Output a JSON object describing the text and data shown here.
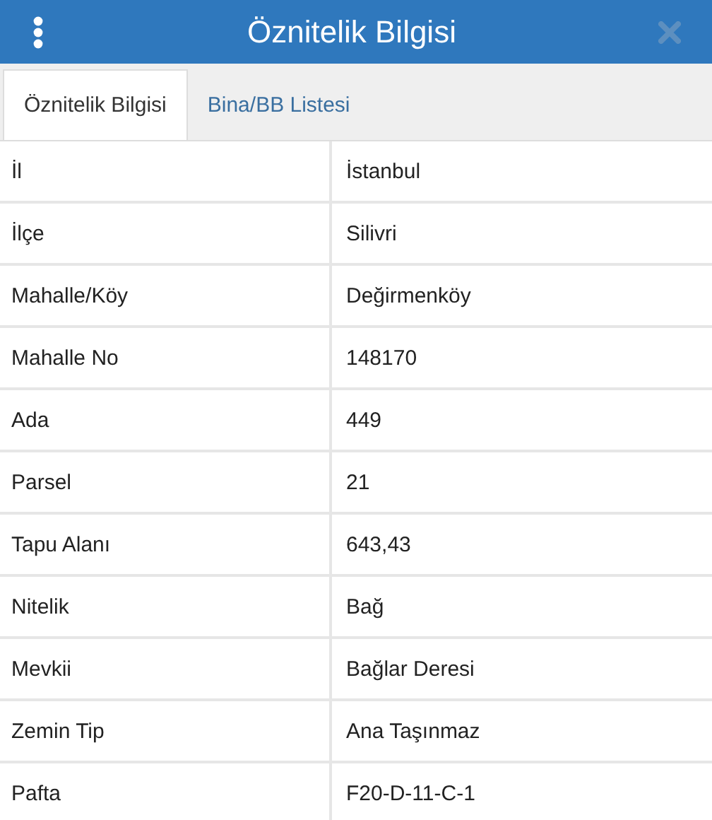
{
  "header": {
    "title": "Öznitelik Bilgisi"
  },
  "tabs": [
    {
      "label": "Öznitelik Bilgisi",
      "selected": true
    },
    {
      "label": "Bina/BB Listesi",
      "selected": false
    }
  ],
  "table": {
    "rows": [
      {
        "label": "İl",
        "value": "İstanbul"
      },
      {
        "label": "İlçe",
        "value": "Silivri"
      },
      {
        "label": "Mahalle/Köy",
        "value": "Değirmenköy"
      },
      {
        "label": "Mahalle No",
        "value": "148170"
      },
      {
        "label": "Ada",
        "value": "449"
      },
      {
        "label": "Parsel",
        "value": "21"
      },
      {
        "label": "Tapu Alanı",
        "value": "643,43"
      },
      {
        "label": "Nitelik",
        "value": "Bağ"
      },
      {
        "label": "Mevkii",
        "value": "Bağlar Deresi"
      },
      {
        "label": "Zemin Tip",
        "value": "Ana Taşınmaz"
      },
      {
        "label": "Pafta",
        "value": "F20-D-11-C-1"
      }
    ]
  }
}
